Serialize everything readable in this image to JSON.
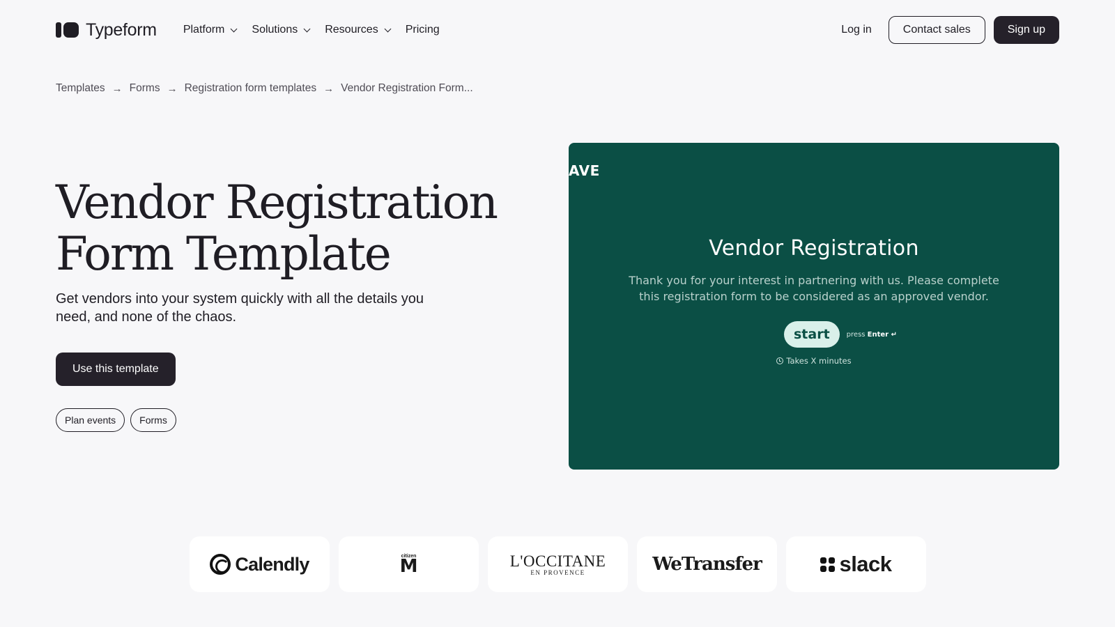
{
  "header": {
    "logo_text": "Typeform",
    "nav": [
      {
        "label": "Platform",
        "has_dropdown": true
      },
      {
        "label": "Solutions",
        "has_dropdown": true
      },
      {
        "label": "Resources",
        "has_dropdown": true
      },
      {
        "label": "Pricing",
        "has_dropdown": false
      }
    ],
    "login_label": "Log in",
    "contact_label": "Contact sales",
    "signup_label": "Sign up"
  },
  "breadcrumb": {
    "items": [
      "Templates",
      "Forms",
      "Registration form templates",
      "Vendor Registration Form..."
    ],
    "separator": "→"
  },
  "hero": {
    "title_line1": "Vendor Registration",
    "title_line2": "Form Template",
    "subtitle": "Get vendors into your system quickly with all the details you need, and none of the chaos.",
    "cta_label": "Use this template",
    "tags": [
      "Plan events",
      "Forms"
    ]
  },
  "preview": {
    "brand_text": "AVE",
    "title": "Vendor Registration",
    "description": "Thank you for your interest in partnering with us. Please complete this registration form to be considered as an approved vendor.",
    "start_label": "start",
    "press_text": "press",
    "press_key": "Enter ↵",
    "duration_text": "Takes X minutes",
    "background_color": "#0b4f45"
  },
  "logos": {
    "calendly": "Calendly",
    "citizen_small": "citizen",
    "citizen_big": "M",
    "occitane_main": "L'OCCITANE",
    "occitane_sub": "EN PROVENCE",
    "wetransfer": "WeTransfer",
    "slack": "slack"
  },
  "colors": {
    "background": "#f7f7f9",
    "primary_dark": "#25212a",
    "preview_green": "#0b4f45",
    "start_button": "#d9f0ea"
  }
}
